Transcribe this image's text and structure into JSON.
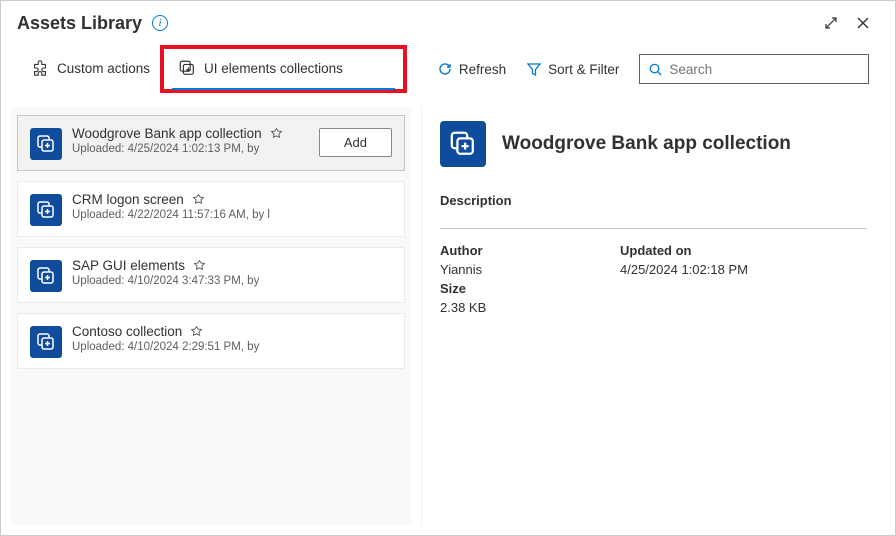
{
  "window": {
    "title": "Assets Library"
  },
  "tabs": {
    "custom_actions": "Custom actions",
    "ui_collections": "UI elements collections"
  },
  "toolbar": {
    "refresh": "Refresh",
    "sort_filter": "Sort & Filter",
    "search_placeholder": "Search"
  },
  "items": [
    {
      "name": "Woodgrove Bank app collection",
      "meta": "Uploaded: 4/25/2024 1:02:13 PM, by",
      "add_label": "Add"
    },
    {
      "name": "CRM logon screen",
      "meta": "Uploaded: 4/22/2024 11:57:16 AM, by l"
    },
    {
      "name": "SAP GUI elements",
      "meta": "Uploaded: 4/10/2024 3:47:33 PM, by"
    },
    {
      "name": "Contoso collection",
      "meta": "Uploaded: 4/10/2024 2:29:51 PM, by"
    }
  ],
  "detail": {
    "title": "Woodgrove Bank app collection",
    "desc_label": "Description",
    "author_label": "Author",
    "author": "Yiannis",
    "updated_label": "Updated on",
    "updated": "4/25/2024 1:02:18 PM",
    "size_label": "Size",
    "size": "2.38 KB"
  }
}
